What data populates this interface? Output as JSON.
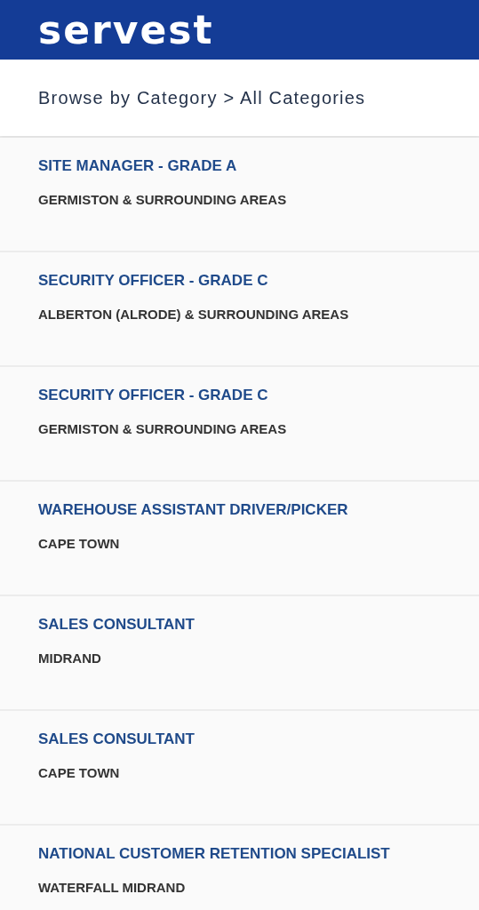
{
  "header": {
    "logo": "servest"
  },
  "breadcrumb": "Browse by Category > All Categories",
  "jobs": [
    {
      "title": "SITE MANAGER - GRADE A",
      "location": "GERMISTON & SURROUNDING AREAS"
    },
    {
      "title": "SECURITY OFFICER - GRADE C",
      "location": "ALBERTON (ALRODE) & SURROUNDING AREAS"
    },
    {
      "title": "SECURITY OFFICER - GRADE C",
      "location": "GERMISTON & SURROUNDING AREAS"
    },
    {
      "title": "WAREHOUSE ASSISTANT DRIVER/PICKER",
      "location": "CAPE TOWN"
    },
    {
      "title": "SALES CONSULTANT",
      "location": "MIDRAND"
    },
    {
      "title": "SALES CONSULTANT",
      "location": "CAPE TOWN"
    },
    {
      "title": "NATIONAL CUSTOMER RETENTION SPECIALIST",
      "location": "WATERFALL MIDRAND"
    }
  ]
}
